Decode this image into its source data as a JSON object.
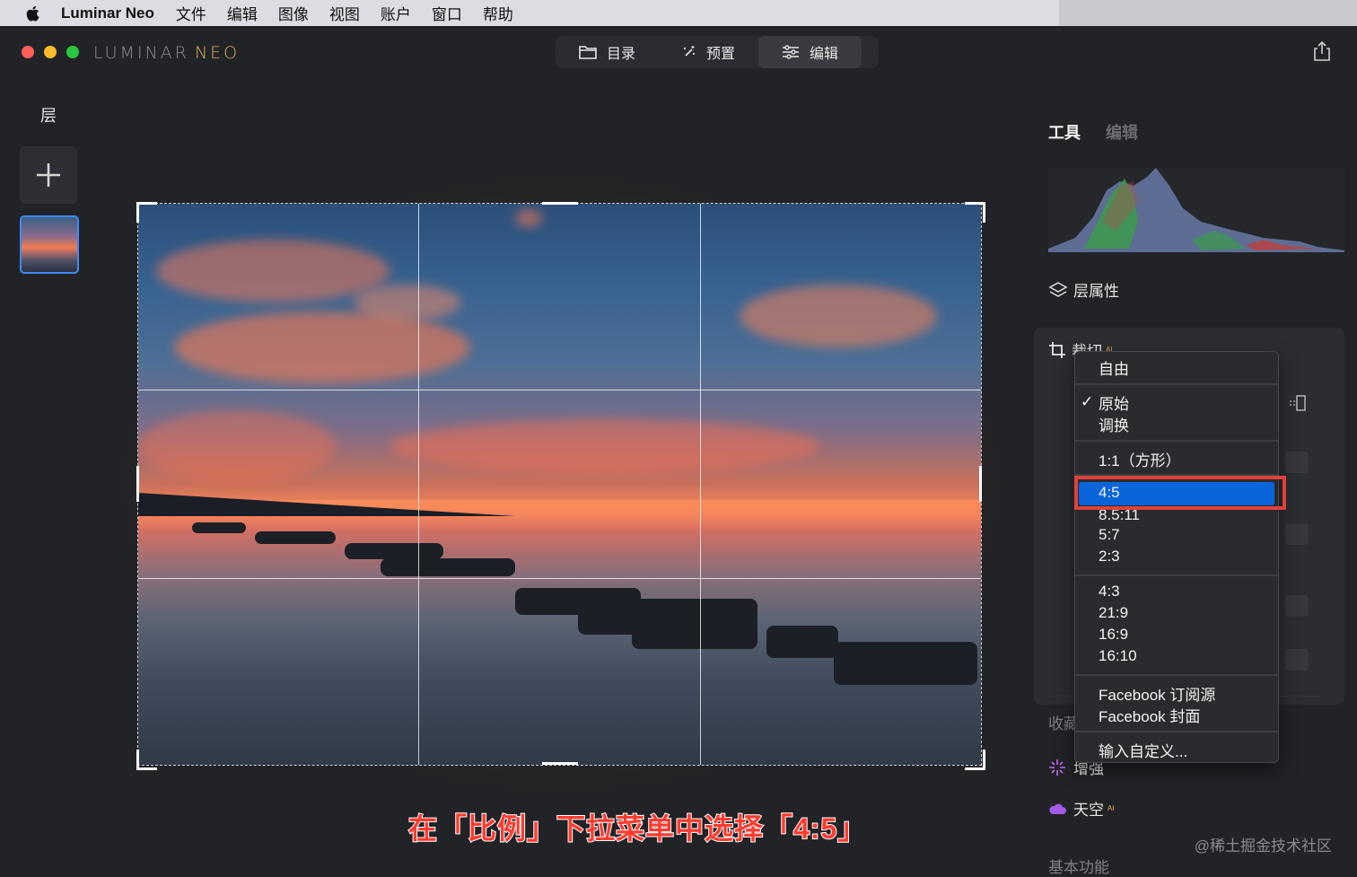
{
  "menubar": {
    "app_name": "Luminar Neo",
    "items": [
      "文件",
      "编辑",
      "图像",
      "视图",
      "账户",
      "窗口",
      "帮助"
    ]
  },
  "window": {
    "logo_main": "LUMINAR",
    "logo_accent": "NEO",
    "nav": {
      "catalog": "目录",
      "presets": "预置",
      "edit": "编辑"
    }
  },
  "layers": {
    "title": "层"
  },
  "right_panel": {
    "tab_tools": "工具",
    "tab_edit": "编辑",
    "layer_properties": "层属性",
    "crop_title": "裁切",
    "crop_ai_badge": "AI",
    "favorites_partial": "收藏",
    "enhance": "增强",
    "sky": "天空",
    "sky_ai_badge": "AI",
    "basic": "基本功能"
  },
  "dropdown": {
    "items": {
      "free": "自由",
      "original": "原始",
      "swap": "调换",
      "square": "1:1（方形）",
      "r4_5": "4:5",
      "r8_5_11": "8.5:11",
      "r5_7": "5:7",
      "r2_3": "2:3",
      "r4_3": "4:3",
      "r21_9": "21:9",
      "r16_9": "16:9",
      "r16_10": "16:10",
      "fb_feed": "Facebook 订阅源",
      "fb_cover": "Facebook 封面",
      "custom": "输入自定义..."
    },
    "checked": "原始",
    "selected": "4:5",
    "check_mark": "✓"
  },
  "caption": "在「比例」下拉菜单中选择「4:5」",
  "watermark": "@稀土掘金技术社区",
  "colors": {
    "accent_blue": "#0a64d9",
    "highlight_red": "#e0413c",
    "logo_gold": "#d8b45a"
  }
}
